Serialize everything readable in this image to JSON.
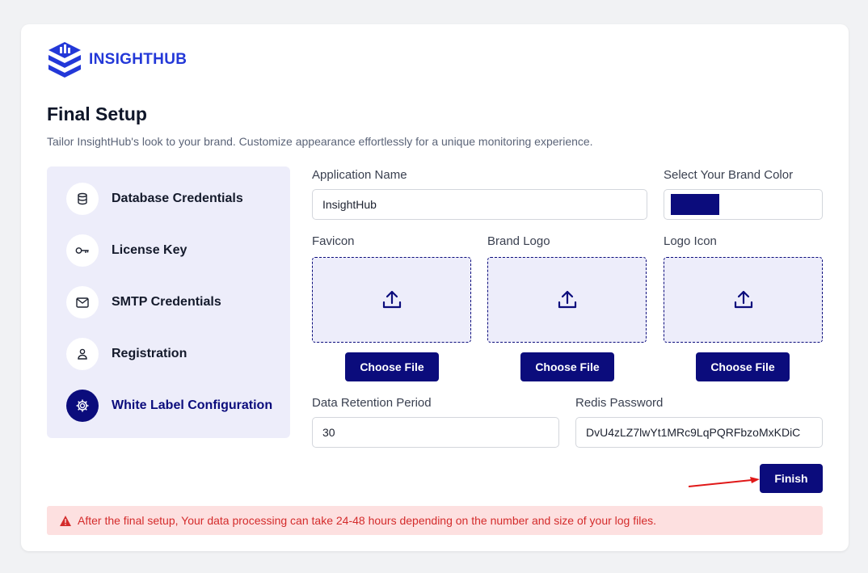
{
  "brand": {
    "logo_text_a": "INSIGHT",
    "logo_text_b": "HUB",
    "logo_icon": "layered-stack-icon",
    "accent_color": "#0b0c7c",
    "logo_color": "#2338d8"
  },
  "page": {
    "title": "Final Setup",
    "subtitle": "Tailor InsightHub's look to your brand. Customize appearance effortlessly for a unique monitoring experience."
  },
  "steps": [
    {
      "label": "Database Credentials",
      "icon": "database-icon",
      "active": false
    },
    {
      "label": "License Key",
      "icon": "key-icon",
      "active": false
    },
    {
      "label": "SMTP Credentials",
      "icon": "mail-icon",
      "active": false
    },
    {
      "label": "Registration",
      "icon": "user-icon",
      "active": false
    },
    {
      "label": "White Label Configuration",
      "icon": "gear-icon",
      "active": true
    }
  ],
  "form": {
    "app_name_label": "Application Name",
    "app_name_value": "InsightHub",
    "brand_color_label": "Select Your Brand Color",
    "brand_color_value": "#0b0c7c",
    "favicon_label": "Favicon",
    "brand_logo_label": "Brand Logo",
    "logo_icon_label": "Logo Icon",
    "choose_file_label": "Choose File",
    "retention_label": "Data Retention Period",
    "retention_value": "30",
    "redis_label": "Redis Password",
    "redis_value": "DvU4zLZ7lwYt1MRc9LqPQRFbzoMxKDiC",
    "finish_label": "Finish"
  },
  "alert": {
    "text": "After the final setup, Your data processing can take 24-48 hours depending on the number and size of your log files.",
    "color": "#d42b2b",
    "icon": "warning-icon"
  }
}
